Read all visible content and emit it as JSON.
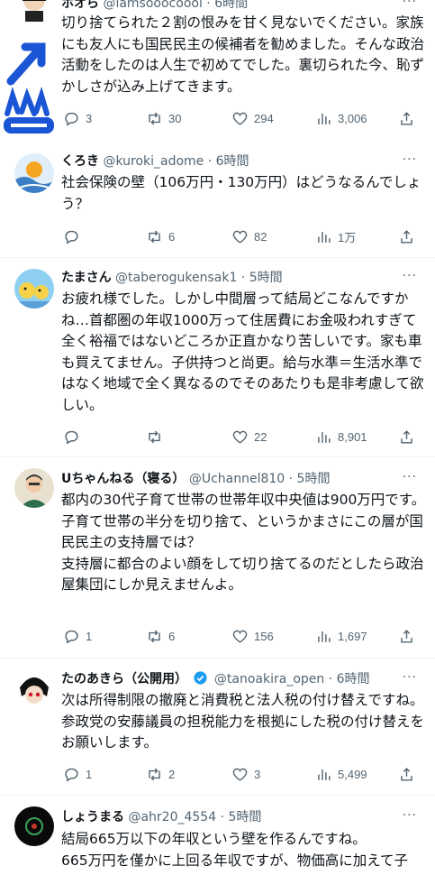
{
  "tweets": [
    {
      "name": "ホオら",
      "handle": "@lamsooocoool",
      "time": "· 6時間",
      "body": "切り捨てられた２割の恨みを甘く見ないでください。家族にも友人にも国民民主の候補者を勧めました。そんな政治活動をしたのは人生で初めてでした。裏切られた今、恥ずかしさが込み上げてきます。",
      "replies": "3",
      "retweets": "30",
      "likes": "294",
      "views": "3,006"
    },
    {
      "name": "くろき",
      "handle": "@kuroki_adome",
      "time": "· 6時間",
      "body": "社会保険の壁（106万円・130万円）はどうなるんでしょう？",
      "replies": "",
      "retweets": "6",
      "likes": "82",
      "views": "1万"
    },
    {
      "name": "たまさん",
      "handle": "@taberogukensak1",
      "time": "· 5時間",
      "body": "お疲れ様でした。しかし中間層って結局どこなんですかね…首都圏の年収1000万って住居費にお金吸われすぎて全く裕福ではないどころか正直かなり苦しいです。家も車も買えてません。子供持つと尚更。給与水準＝生活水準ではなく地域で全く異なるのでそのあたりも是非考慮して欲しい。",
      "replies": "",
      "retweets": "",
      "likes": "22",
      "views": "8,901"
    },
    {
      "name": "Uちゃんねる（寝る）",
      "handle": "@Uchannel810",
      "time": "· 5時間",
      "body": "都内の30代子育て世帯の世帯年収中央値は900万円です。\n子育て世帯の半分を切り捨て、というかまさにこの層が国民民主の支持層では？\n支持層に都合のよい顔をして切り捨てるのだとしたら政治屋集団にしか見えませんよ。",
      "replies": "1",
      "retweets": "6",
      "likes": "156",
      "views": "1,697"
    },
    {
      "name": "たのあきら（公開用）",
      "handle": "@tanoakira_open",
      "time": "· 6時間",
      "body": "次は所得制限の撤廃と消費税と法人税の付け替えですね。参政党の安藤議員の担税能力を根拠にした税の付け替えをお願いします。",
      "replies": "1",
      "retweets": "2",
      "likes": "3",
      "views": "5,499"
    },
    {
      "name": "しょうまる",
      "handle": "@ahr20_4554",
      "time": "· 5時間",
      "body": "結局665万以下の年収という壁を作るんですね。\n665万円を僅かに上回る年収ですが、物価高に加えて子",
      "replies": "",
      "retweets": "",
      "likes": "",
      "views": ""
    }
  ],
  "more_label": "···",
  "icons": [
    "reply-icon",
    "retweet-icon",
    "like-icon",
    "views-icon",
    "share-icon",
    "verified-badge-icon"
  ],
  "colors": {
    "text": "#0f1419",
    "muted": "#536471",
    "verified": "#1d9bf0",
    "divider": "#eff3f4"
  }
}
